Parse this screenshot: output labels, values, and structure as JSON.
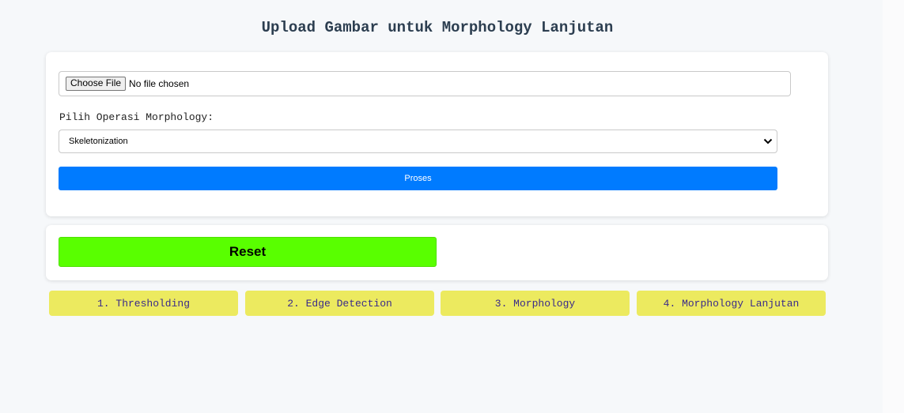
{
  "page": {
    "title": "Upload Gambar untuk Morphology Lanjutan"
  },
  "upload": {
    "choose_label": "Choose File",
    "status": "No file chosen"
  },
  "operation": {
    "label": "Pilih Operasi Morphology:",
    "selected": "Skeletonization"
  },
  "buttons": {
    "proses": "Proses",
    "reset": "Reset"
  },
  "nav": [
    {
      "label": "1. Thresholding"
    },
    {
      "label": "2. Edge Detection"
    },
    {
      "label": "3. Morphology"
    },
    {
      "label": "4. Morphology Lanjutan"
    }
  ],
  "colors": {
    "proses_bg": "#007bff",
    "reset_bg": "#59ff00",
    "nav_bg": "#ecea5f",
    "title": "#2c3e50"
  }
}
